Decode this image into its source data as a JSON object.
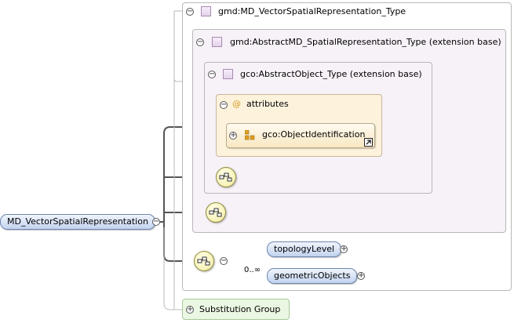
{
  "root": {
    "label": "MD_VectorSpatialRepresentation",
    "toggle": "−"
  },
  "vector_type": {
    "label": "gmd:MD_VectorSpatialRepresentation_Type",
    "toggle": "−"
  },
  "abstract_type": {
    "label": "gmd:AbstractMD_SpatialRepresentation_Type (extension base)",
    "toggle": "−"
  },
  "object_type": {
    "label": "gco:AbstractObject_Type (extension base)",
    "toggle": "−"
  },
  "attributes": {
    "icon": "@",
    "label": "attributes",
    "toggle": "−"
  },
  "object_identification": {
    "label": "gco:ObjectIdentification",
    "toggle": "+"
  },
  "sequence": {
    "toggle": "−",
    "multiplicity": "0..∞",
    "items": [
      {
        "label": "topologyLevel",
        "toggle": "+"
      },
      {
        "label": "geometricObjects",
        "toggle": "+"
      }
    ]
  },
  "substitution_group": {
    "label": "Substitution Group",
    "toggle": "+"
  },
  "colors": {
    "type_bg": "#f7f1f8",
    "attr_bg": "#fdf2dc",
    "element_fill": "#c2d3ef",
    "group_bg": "#eaf7e2"
  }
}
